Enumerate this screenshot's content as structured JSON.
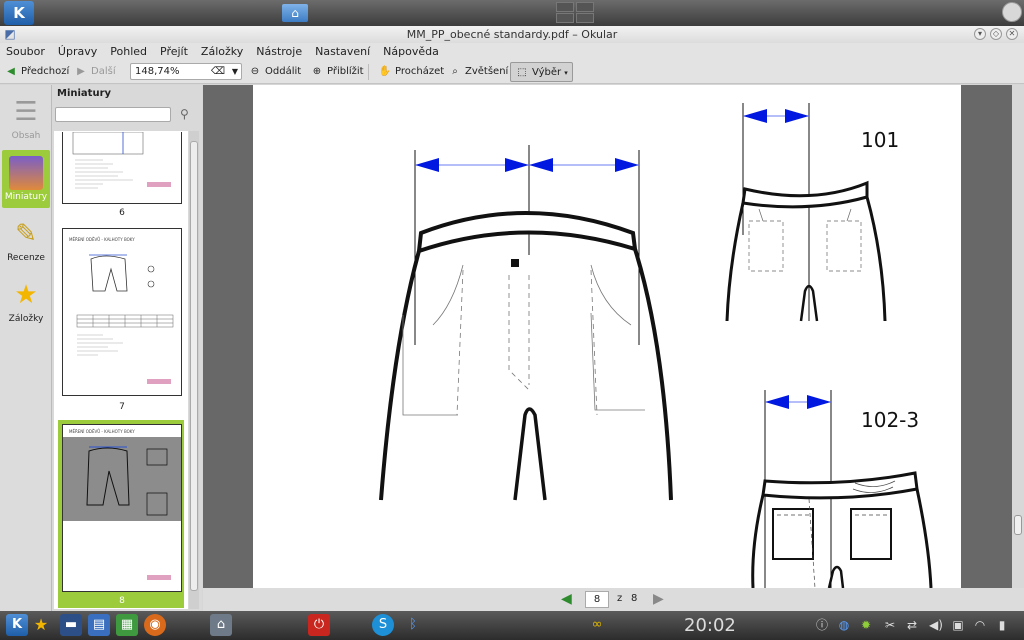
{
  "window": {
    "title": "MM_PP_obecné standardy.pdf – Okular"
  },
  "menu": [
    "Soubor",
    "Úpravy",
    "Pohled",
    "Přejít",
    "Záložky",
    "Nástroje",
    "Nastavení",
    "Nápověda"
  ],
  "toolbar": {
    "prev_label": "Předchozí",
    "next_label": "Další",
    "zoom_value": "148,74%",
    "zoom_out_label": "Oddálit",
    "zoom_in_label": "Přiblížit",
    "browse_label": "Procházet",
    "magnify_label": "Zvětšení",
    "select_label": "Výběr"
  },
  "sidebar": {
    "items": [
      {
        "label": "Obsah",
        "icon": "contents-icon"
      },
      {
        "label": "Miniatury",
        "icon": "thumbnails-icon"
      },
      {
        "label": "Recenze",
        "icon": "pen-icon"
      },
      {
        "label": "Záložky",
        "icon": "star-icon"
      }
    ]
  },
  "thumbnails": {
    "title": "Miniatury",
    "pages": [
      "6",
      "7",
      "8"
    ],
    "page7_header": "MĚŘENÍ ODĚVŮ - KALHOTY BOKY",
    "page8_header": "MĚŘENÍ ODĚVŮ - KALHOTY BOKY"
  },
  "document": {
    "label_101": "101",
    "label_1023": "102-3"
  },
  "pagenav": {
    "current": "8",
    "of": "z",
    "total": "8"
  },
  "taskbar": {
    "clock": "20:02"
  }
}
